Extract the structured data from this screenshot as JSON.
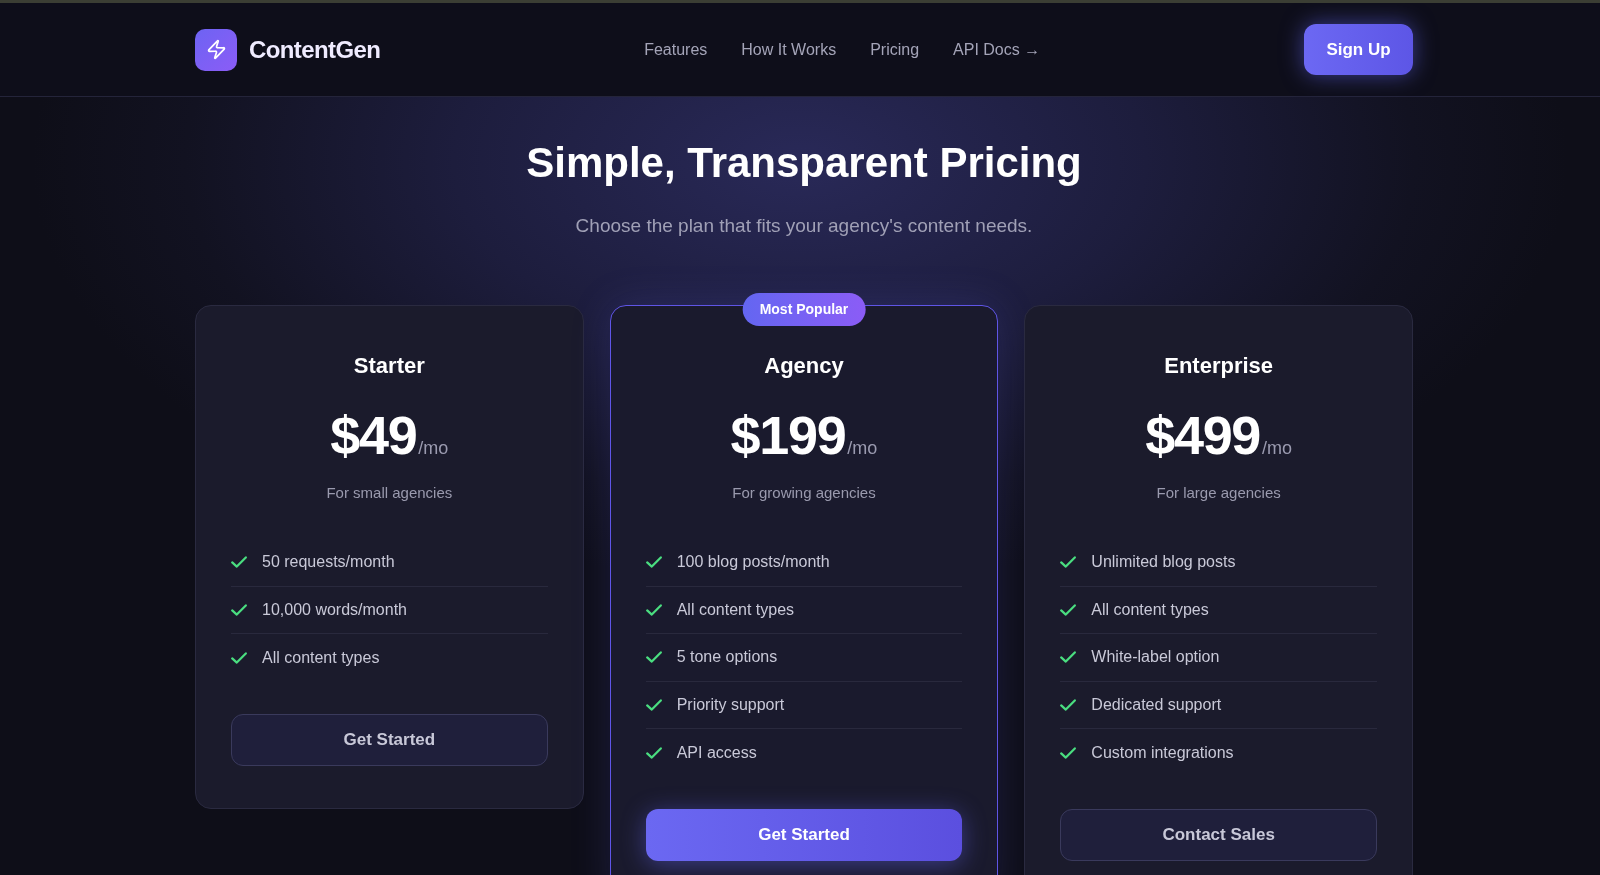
{
  "header": {
    "logo": "ContentGen",
    "nav": [
      "Features",
      "How It Works",
      "Pricing",
      "API Docs →"
    ],
    "button": "Sign Up"
  },
  "hero": {
    "title": "Simple, Transparent Pricing",
    "subtitle": "Choose the plan that fits your agency's content needs."
  },
  "plans": [
    {
      "name": "Starter",
      "price": "$49",
      "period": "/mo",
      "description": "For small agencies",
      "featured": false,
      "features": [
        "50 requests/month",
        "10,000 words/month",
        "All content types"
      ],
      "button": "Get Started"
    },
    {
      "name": "Agency",
      "badge": "Most Popular",
      "price": "$199",
      "period": "/mo",
      "description": "For growing agencies",
      "featured": true,
      "features": [
        "100 blog posts/month",
        "All content types",
        "5 tone options",
        "Priority support",
        "API access"
      ],
      "button": "Get Started"
    },
    {
      "name": "Enterprise",
      "price": "$499",
      "period": "/mo",
      "description": "For large agencies",
      "featured": false,
      "features": [
        "Unlimited blog posts",
        "All content types",
        "White-label option",
        "Dedicated support",
        "Custom integrations"
      ],
      "button": "Contact Sales"
    }
  ]
}
